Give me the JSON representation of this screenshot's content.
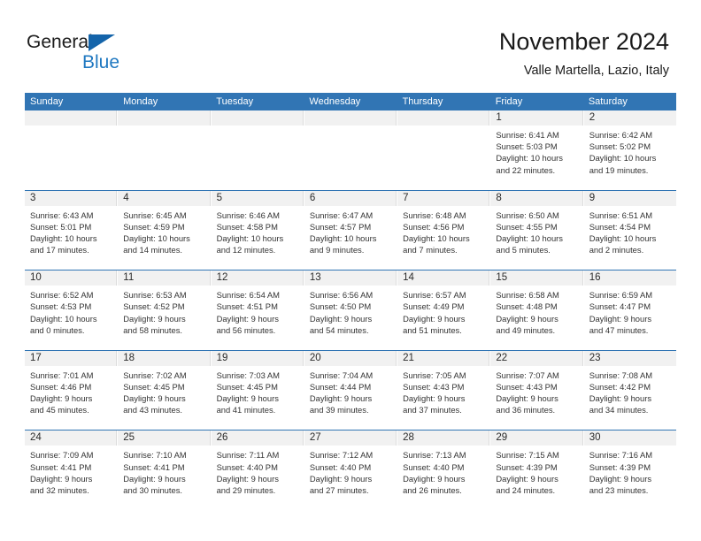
{
  "brand": {
    "name_part1": "General",
    "name_part2": "Blue",
    "triangle_color": "#1464aa",
    "blue_color": "#1f78c1"
  },
  "header": {
    "title": "November 2024",
    "subtitle": "Valle Martella, Lazio, Italy"
  },
  "theme": {
    "header_blue": "#3175b4",
    "daynum_gray": "#f1f1f1",
    "text": "#333333"
  },
  "weekdays": [
    "Sunday",
    "Monday",
    "Tuesday",
    "Wednesday",
    "Thursday",
    "Friday",
    "Saturday"
  ],
  "weeks": [
    [
      {
        "day": "",
        "sunrise": "",
        "sunset": "",
        "daylight_l1": "",
        "daylight_l2": "",
        "empty": true
      },
      {
        "day": "",
        "sunrise": "",
        "sunset": "",
        "daylight_l1": "",
        "daylight_l2": "",
        "empty": true
      },
      {
        "day": "",
        "sunrise": "",
        "sunset": "",
        "daylight_l1": "",
        "daylight_l2": "",
        "empty": true
      },
      {
        "day": "",
        "sunrise": "",
        "sunset": "",
        "daylight_l1": "",
        "daylight_l2": "",
        "empty": true
      },
      {
        "day": "",
        "sunrise": "",
        "sunset": "",
        "daylight_l1": "",
        "daylight_l2": "",
        "empty": true
      },
      {
        "day": "1",
        "sunrise": "Sunrise: 6:41 AM",
        "sunset": "Sunset: 5:03 PM",
        "daylight_l1": "Daylight: 10 hours",
        "daylight_l2": "and 22 minutes.",
        "empty": false
      },
      {
        "day": "2",
        "sunrise": "Sunrise: 6:42 AM",
        "sunset": "Sunset: 5:02 PM",
        "daylight_l1": "Daylight: 10 hours",
        "daylight_l2": "and 19 minutes.",
        "empty": false
      }
    ],
    [
      {
        "day": "3",
        "sunrise": "Sunrise: 6:43 AM",
        "sunset": "Sunset: 5:01 PM",
        "daylight_l1": "Daylight: 10 hours",
        "daylight_l2": "and 17 minutes.",
        "empty": false
      },
      {
        "day": "4",
        "sunrise": "Sunrise: 6:45 AM",
        "sunset": "Sunset: 4:59 PM",
        "daylight_l1": "Daylight: 10 hours",
        "daylight_l2": "and 14 minutes.",
        "empty": false
      },
      {
        "day": "5",
        "sunrise": "Sunrise: 6:46 AM",
        "sunset": "Sunset: 4:58 PM",
        "daylight_l1": "Daylight: 10 hours",
        "daylight_l2": "and 12 minutes.",
        "empty": false
      },
      {
        "day": "6",
        "sunrise": "Sunrise: 6:47 AM",
        "sunset": "Sunset: 4:57 PM",
        "daylight_l1": "Daylight: 10 hours",
        "daylight_l2": "and 9 minutes.",
        "empty": false
      },
      {
        "day": "7",
        "sunrise": "Sunrise: 6:48 AM",
        "sunset": "Sunset: 4:56 PM",
        "daylight_l1": "Daylight: 10 hours",
        "daylight_l2": "and 7 minutes.",
        "empty": false
      },
      {
        "day": "8",
        "sunrise": "Sunrise: 6:50 AM",
        "sunset": "Sunset: 4:55 PM",
        "daylight_l1": "Daylight: 10 hours",
        "daylight_l2": "and 5 minutes.",
        "empty": false
      },
      {
        "day": "9",
        "sunrise": "Sunrise: 6:51 AM",
        "sunset": "Sunset: 4:54 PM",
        "daylight_l1": "Daylight: 10 hours",
        "daylight_l2": "and 2 minutes.",
        "empty": false
      }
    ],
    [
      {
        "day": "10",
        "sunrise": "Sunrise: 6:52 AM",
        "sunset": "Sunset: 4:53 PM",
        "daylight_l1": "Daylight: 10 hours",
        "daylight_l2": "and 0 minutes.",
        "empty": false
      },
      {
        "day": "11",
        "sunrise": "Sunrise: 6:53 AM",
        "sunset": "Sunset: 4:52 PM",
        "daylight_l1": "Daylight: 9 hours",
        "daylight_l2": "and 58 minutes.",
        "empty": false
      },
      {
        "day": "12",
        "sunrise": "Sunrise: 6:54 AM",
        "sunset": "Sunset: 4:51 PM",
        "daylight_l1": "Daylight: 9 hours",
        "daylight_l2": "and 56 minutes.",
        "empty": false
      },
      {
        "day": "13",
        "sunrise": "Sunrise: 6:56 AM",
        "sunset": "Sunset: 4:50 PM",
        "daylight_l1": "Daylight: 9 hours",
        "daylight_l2": "and 54 minutes.",
        "empty": false
      },
      {
        "day": "14",
        "sunrise": "Sunrise: 6:57 AM",
        "sunset": "Sunset: 4:49 PM",
        "daylight_l1": "Daylight: 9 hours",
        "daylight_l2": "and 51 minutes.",
        "empty": false
      },
      {
        "day": "15",
        "sunrise": "Sunrise: 6:58 AM",
        "sunset": "Sunset: 4:48 PM",
        "daylight_l1": "Daylight: 9 hours",
        "daylight_l2": "and 49 minutes.",
        "empty": false
      },
      {
        "day": "16",
        "sunrise": "Sunrise: 6:59 AM",
        "sunset": "Sunset: 4:47 PM",
        "daylight_l1": "Daylight: 9 hours",
        "daylight_l2": "and 47 minutes.",
        "empty": false
      }
    ],
    [
      {
        "day": "17",
        "sunrise": "Sunrise: 7:01 AM",
        "sunset": "Sunset: 4:46 PM",
        "daylight_l1": "Daylight: 9 hours",
        "daylight_l2": "and 45 minutes.",
        "empty": false
      },
      {
        "day": "18",
        "sunrise": "Sunrise: 7:02 AM",
        "sunset": "Sunset: 4:45 PM",
        "daylight_l1": "Daylight: 9 hours",
        "daylight_l2": "and 43 minutes.",
        "empty": false
      },
      {
        "day": "19",
        "sunrise": "Sunrise: 7:03 AM",
        "sunset": "Sunset: 4:45 PM",
        "daylight_l1": "Daylight: 9 hours",
        "daylight_l2": "and 41 minutes.",
        "empty": false
      },
      {
        "day": "20",
        "sunrise": "Sunrise: 7:04 AM",
        "sunset": "Sunset: 4:44 PM",
        "daylight_l1": "Daylight: 9 hours",
        "daylight_l2": "and 39 minutes.",
        "empty": false
      },
      {
        "day": "21",
        "sunrise": "Sunrise: 7:05 AM",
        "sunset": "Sunset: 4:43 PM",
        "daylight_l1": "Daylight: 9 hours",
        "daylight_l2": "and 37 minutes.",
        "empty": false
      },
      {
        "day": "22",
        "sunrise": "Sunrise: 7:07 AM",
        "sunset": "Sunset: 4:43 PM",
        "daylight_l1": "Daylight: 9 hours",
        "daylight_l2": "and 36 minutes.",
        "empty": false
      },
      {
        "day": "23",
        "sunrise": "Sunrise: 7:08 AM",
        "sunset": "Sunset: 4:42 PM",
        "daylight_l1": "Daylight: 9 hours",
        "daylight_l2": "and 34 minutes.",
        "empty": false
      }
    ],
    [
      {
        "day": "24",
        "sunrise": "Sunrise: 7:09 AM",
        "sunset": "Sunset: 4:41 PM",
        "daylight_l1": "Daylight: 9 hours",
        "daylight_l2": "and 32 minutes.",
        "empty": false
      },
      {
        "day": "25",
        "sunrise": "Sunrise: 7:10 AM",
        "sunset": "Sunset: 4:41 PM",
        "daylight_l1": "Daylight: 9 hours",
        "daylight_l2": "and 30 minutes.",
        "empty": false
      },
      {
        "day": "26",
        "sunrise": "Sunrise: 7:11 AM",
        "sunset": "Sunset: 4:40 PM",
        "daylight_l1": "Daylight: 9 hours",
        "daylight_l2": "and 29 minutes.",
        "empty": false
      },
      {
        "day": "27",
        "sunrise": "Sunrise: 7:12 AM",
        "sunset": "Sunset: 4:40 PM",
        "daylight_l1": "Daylight: 9 hours",
        "daylight_l2": "and 27 minutes.",
        "empty": false
      },
      {
        "day": "28",
        "sunrise": "Sunrise: 7:13 AM",
        "sunset": "Sunset: 4:40 PM",
        "daylight_l1": "Daylight: 9 hours",
        "daylight_l2": "and 26 minutes.",
        "empty": false
      },
      {
        "day": "29",
        "sunrise": "Sunrise: 7:15 AM",
        "sunset": "Sunset: 4:39 PM",
        "daylight_l1": "Daylight: 9 hours",
        "daylight_l2": "and 24 minutes.",
        "empty": false
      },
      {
        "day": "30",
        "sunrise": "Sunrise: 7:16 AM",
        "sunset": "Sunset: 4:39 PM",
        "daylight_l1": "Daylight: 9 hours",
        "daylight_l2": "and 23 minutes.",
        "empty": false
      }
    ]
  ]
}
